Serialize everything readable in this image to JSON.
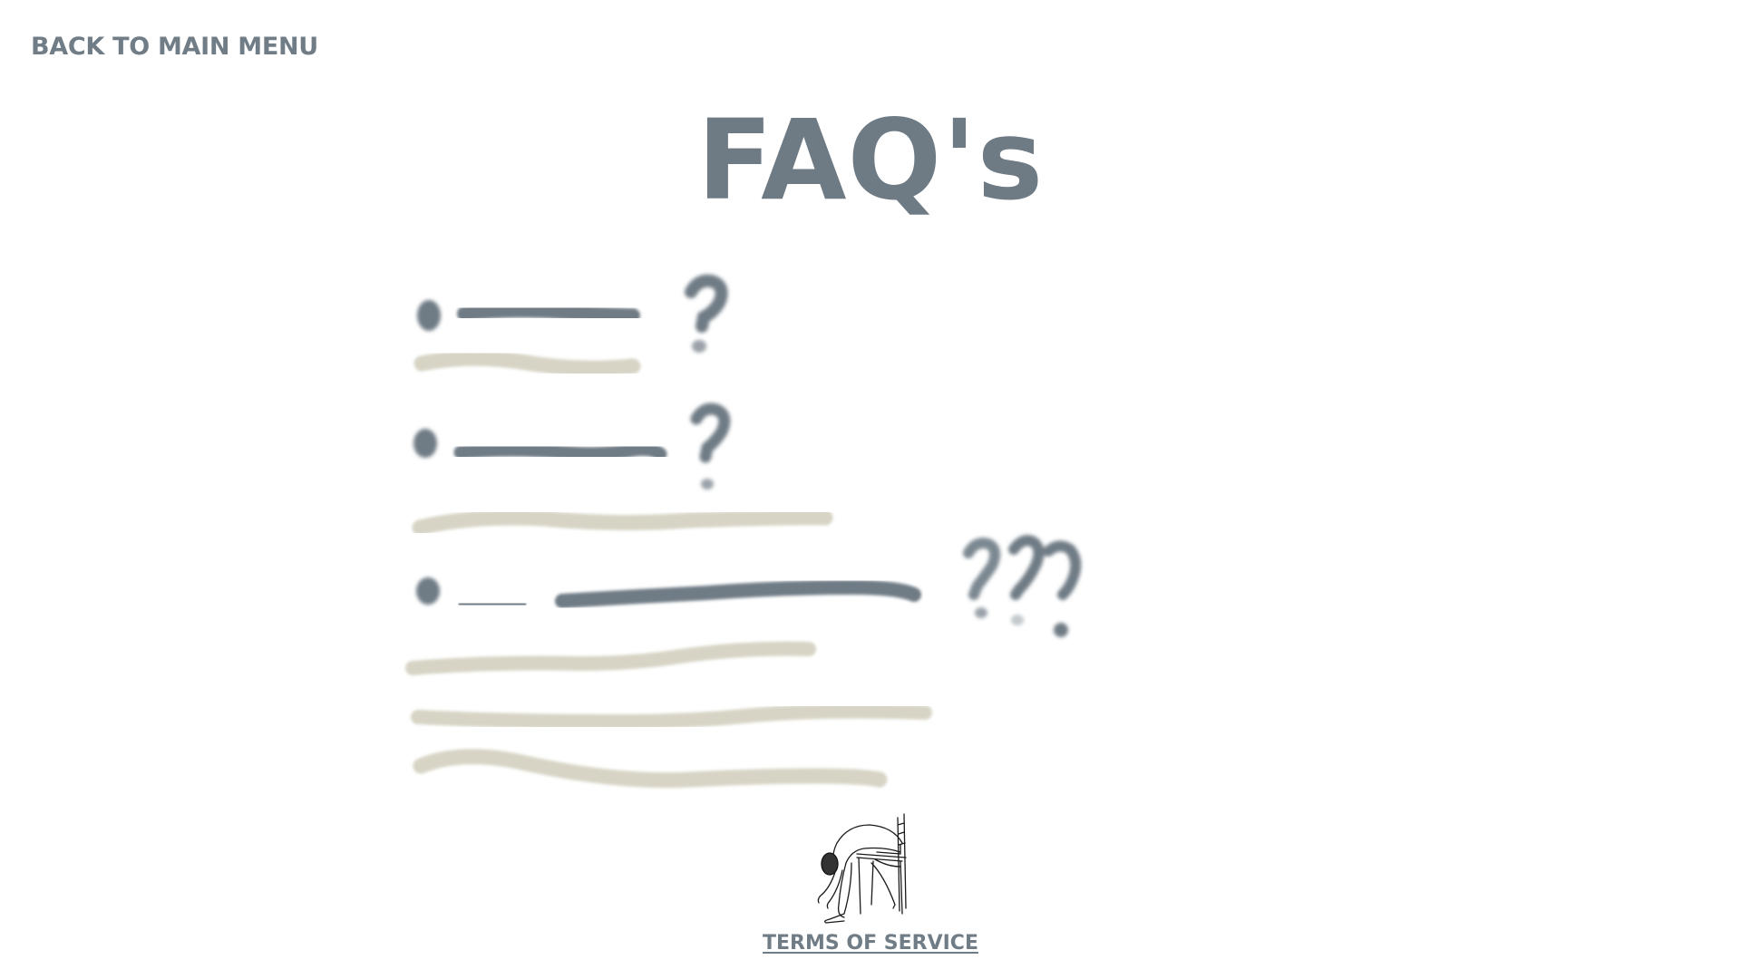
{
  "nav": {
    "back_label": "BACK TO MAIN MENU"
  },
  "page": {
    "title": "FAQ's"
  },
  "footer": {
    "terms_label": "TERMS OF SERVICE"
  },
  "colors": {
    "text": "#6e7a84",
    "question_stroke": "#6f7b85",
    "answer_stroke": "#d7d4c5",
    "background": "#ffffff"
  },
  "icons": {
    "illustration": "person-bent-over-chair-drawing-icon"
  }
}
